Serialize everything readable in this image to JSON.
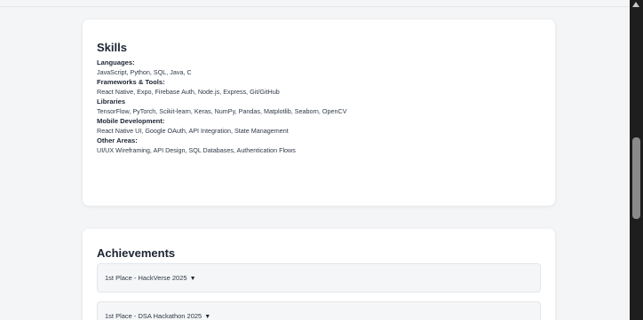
{
  "skills": {
    "title": "Skills",
    "categories": [
      {
        "label": "Languages:",
        "items": "JavaScript, Python, SQL, Java, C"
      },
      {
        "label": "Frameworks & Tools:",
        "items": "React Native, Expo, Firebase Auth, Node.js, Express, Git/GitHub"
      },
      {
        "label": "Libraries",
        "items": "TensorFlow, PyTorch, Scikit-learn, Keras, NumPy, Pandas, Matplotlib, Seaborn, OpenCV"
      },
      {
        "label": "Mobile Development:",
        "items": "React Native UI, Google OAuth, API Integration, State Management"
      },
      {
        "label": "Other Areas:",
        "items": "UI/UX Wireframing, API Design, SQL Databases, Authentication Flows"
      }
    ]
  },
  "achievements": {
    "title": "Achievements",
    "items": [
      {
        "label": "1st Place - HackVerse 2025",
        "arrow": "▼"
      },
      {
        "label": "1st Place - DSA Hackathon 2025",
        "arrow": "▼"
      }
    ]
  }
}
